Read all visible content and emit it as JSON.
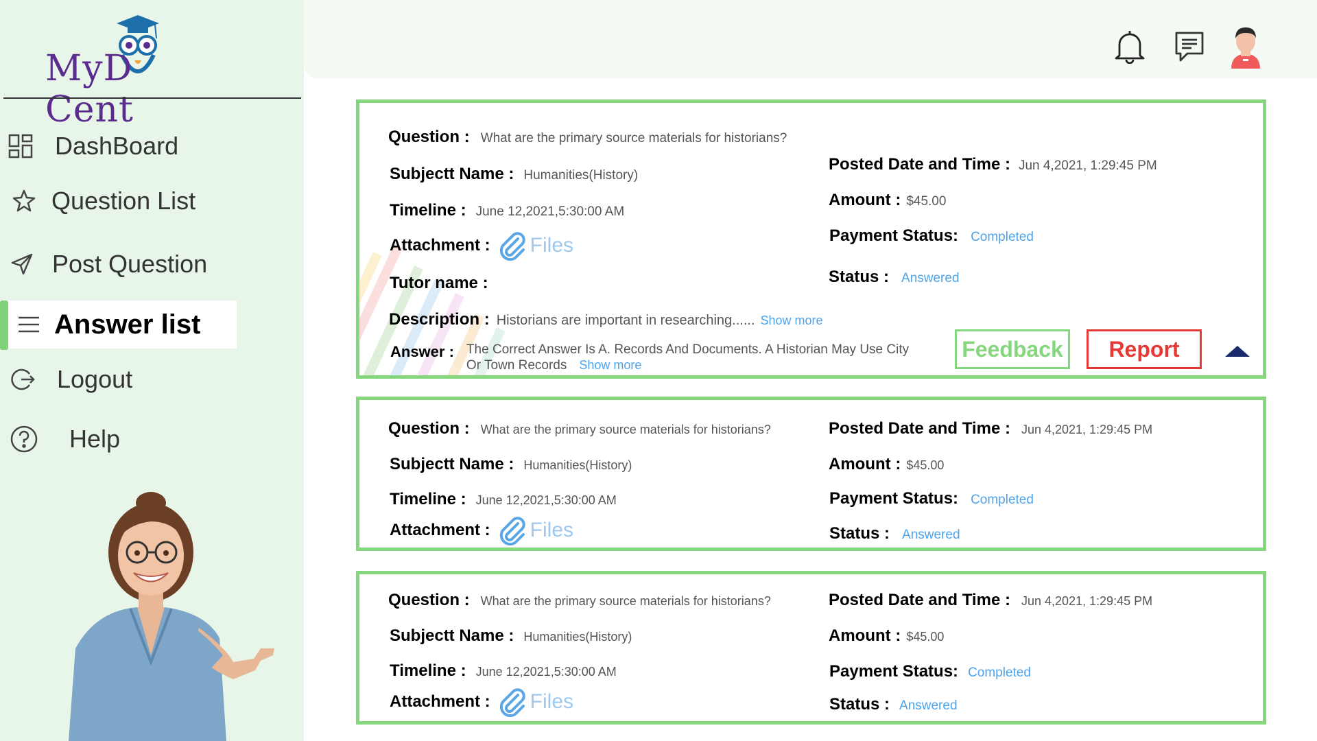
{
  "brand": {
    "name_left": "MyD",
    "name_right": "Cent"
  },
  "sidebar": {
    "items": [
      {
        "label": "DashBoard",
        "icon": "dashboard-grid-icon"
      },
      {
        "label": "Question List",
        "icon": "star-icon"
      },
      {
        "label": "Post Question",
        "icon": "send-icon"
      },
      {
        "label": "Answer list",
        "icon": "menu-lines-icon",
        "active": true
      },
      {
        "label": "Logout",
        "icon": "logout-icon"
      },
      {
        "label": "Help",
        "icon": "help-icon"
      }
    ]
  },
  "header": {
    "icons": [
      "bell-icon",
      "message-icon",
      "avatar-icon"
    ]
  },
  "labels": {
    "question": "Question :",
    "subject": "Subjectt Name :",
    "timeline": "Timeline :",
    "attachment": "Attachment :",
    "tutor": "Tutor name :",
    "description": "Description :",
    "answer": "Answer :",
    "posted": "Posted Date and Time :",
    "amount": "Amount :",
    "payment": "Payment Status:",
    "status": "Status :",
    "files": "Files",
    "show_more": "Show more",
    "feedback": "Feedback",
    "report": "Report"
  },
  "cards": [
    {
      "question": "What are the primary source materials for historians?",
      "subject": "Humanities(History)",
      "timeline": "June 12,2021,5:30:00 AM",
      "posted": "Jun 4,2021, 1:29:45 PM",
      "amount": "$45.00",
      "payment": "Completed",
      "status": "Answered",
      "tutor": "",
      "description": "Historians are important in researching......",
      "answer_line1": "The Correct Answer Is A. Records And Documents. A Historian May Use City",
      "answer_line2": "Or Town Records"
    },
    {
      "question": "What are the primary source materials for historians?",
      "subject": "Humanities(History)",
      "timeline": "June 12,2021,5:30:00 AM",
      "posted": "Jun 4,2021, 1:29:45 PM",
      "amount": "$45.00",
      "payment": "Completed",
      "status": "Answered"
    },
    {
      "question": "What are the primary source materials for historians?",
      "subject": "Humanities(History)",
      "timeline": "June 12,2021,5:30:00 AM",
      "posted": "Jun 4,2021, 1:29:45 PM",
      "amount": "$45.00",
      "payment": "Completed",
      "status": "Answered"
    }
  ],
  "colors": {
    "accent_green": "#85d77e",
    "link_blue": "#4da3ec",
    "report_red": "#e53935",
    "brand_purple": "#5b2c8f"
  }
}
